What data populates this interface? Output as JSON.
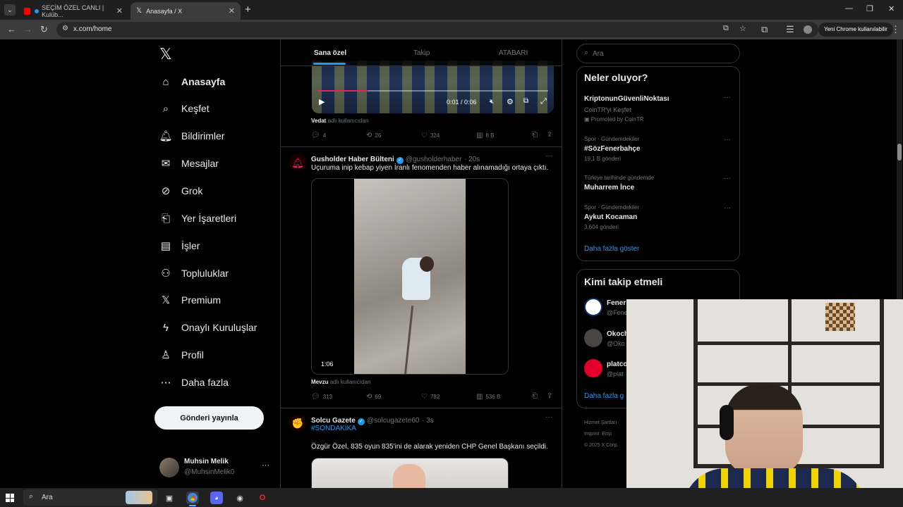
{
  "browser": {
    "tabs": [
      {
        "title": "SEÇİM ÖZEL CANLI | Kulüb..."
      },
      {
        "title": "Anasayfa / X"
      }
    ],
    "new_tab_label": "+",
    "url": "x.com/home",
    "profile_chip": "Yeni Chrome kullanılabilir",
    "window_controls": {
      "minimize": "—",
      "restore": "❐",
      "close": "✕"
    }
  },
  "sidebar": {
    "logo": "𝕏",
    "items": [
      {
        "label": "Anasayfa",
        "icon": "home-icon",
        "glyph": "⌂"
      },
      {
        "label": "Keşfet",
        "icon": "search-icon",
        "glyph": "⌕"
      },
      {
        "label": "Bildirimler",
        "icon": "bell-icon",
        "glyph": "🔔︎"
      },
      {
        "label": "Mesajlar",
        "icon": "envelope-icon",
        "glyph": "✉"
      },
      {
        "label": "Grok",
        "icon": "grok-icon",
        "glyph": "⊘"
      },
      {
        "label": "Yer İşaretleri",
        "icon": "bookmark-icon",
        "glyph": "⎗"
      },
      {
        "label": "İşler",
        "icon": "briefcase-icon",
        "glyph": "▤"
      },
      {
        "label": "Topluluklar",
        "icon": "people-icon",
        "glyph": "⚇"
      },
      {
        "label": "Premium",
        "icon": "x-logo-icon",
        "glyph": "𝕏"
      },
      {
        "label": "Onaylı Kuruluşlar",
        "icon": "lightning-icon",
        "glyph": "ϟ"
      },
      {
        "label": "Profil",
        "icon": "person-icon",
        "glyph": "♙"
      },
      {
        "label": "Daha fazla",
        "icon": "more-circle-icon",
        "glyph": "⋯"
      }
    ],
    "post_button": "Gönderi yayınla",
    "account": {
      "name": "Muhsin Melik",
      "handle": "@MuhsinMelik0",
      "more": "···"
    }
  },
  "timeline": {
    "tabs": [
      "Sana özel",
      "Takip",
      "ATABARI"
    ],
    "tweet1": {
      "video_time": "0:01 / 0:06",
      "attribution_user": "Vedat",
      "attribution_text": "adlı kullanıcıdan",
      "replies": "4",
      "reposts": "26",
      "likes": "324",
      "views": "8 B"
    },
    "tweet2": {
      "author": "Gusholder Haber Bülteni",
      "handle": "@gusholderhaber",
      "time": "· 20s",
      "text": "Uçuruma inip kebap yiyen İranlı fenomenden haber alınamadığı ortaya çıktı.",
      "video_duration": "1:06",
      "attribution_user": "Mevzu",
      "attribution_text": "adlı kullanıcıdan",
      "replies": "313",
      "reposts": "69",
      "likes": "782",
      "views": "536 B"
    },
    "tweet3": {
      "author": "Solcu Gazete",
      "handle": "@solcugazete60",
      "time": "· 3s",
      "hashtag": "#SONDAKİKA",
      "text": "Özgür Özel, 835 oyun 835'ini de alarak yeniden CHP Genel Başkanı seçildi."
    }
  },
  "right": {
    "search_placeholder": "Ara",
    "trends_title": "Neler oluyor?",
    "trends": [
      {
        "category": "",
        "name": "KriptonunGüvenliNoktası",
        "sub": "CoinTR'yi Keşfet",
        "promo": "Promoted by CoinTR"
      },
      {
        "category": "Spor · Gündemdekiler",
        "name": "#SözFenerbahçe",
        "sub": "19,1 B gönderi"
      },
      {
        "category": "Türkiye tarihinde gündemde",
        "name": "Muharrem İnce",
        "sub": ""
      },
      {
        "category": "Spor · Gündemdekiler",
        "name": "Aykut Kocaman",
        "sub": "3.604 gönderi"
      }
    ],
    "show_more": "Daha fazla göster",
    "follow_title": "Kimi takip etmeli",
    "follow": [
      {
        "name": "Fenerb",
        "handle": "@Fene"
      },
      {
        "name": "Okoch",
        "handle": "@Oko"
      },
      {
        "name": "platco",
        "handle": "@plat"
      }
    ],
    "follow_more": "Daha fazla g",
    "footer": [
      "Hizmet Şartları",
      "Imprint",
      "Erişi",
      "© 2025 X Corp."
    ]
  },
  "taskbar": {
    "search": "Ara"
  }
}
